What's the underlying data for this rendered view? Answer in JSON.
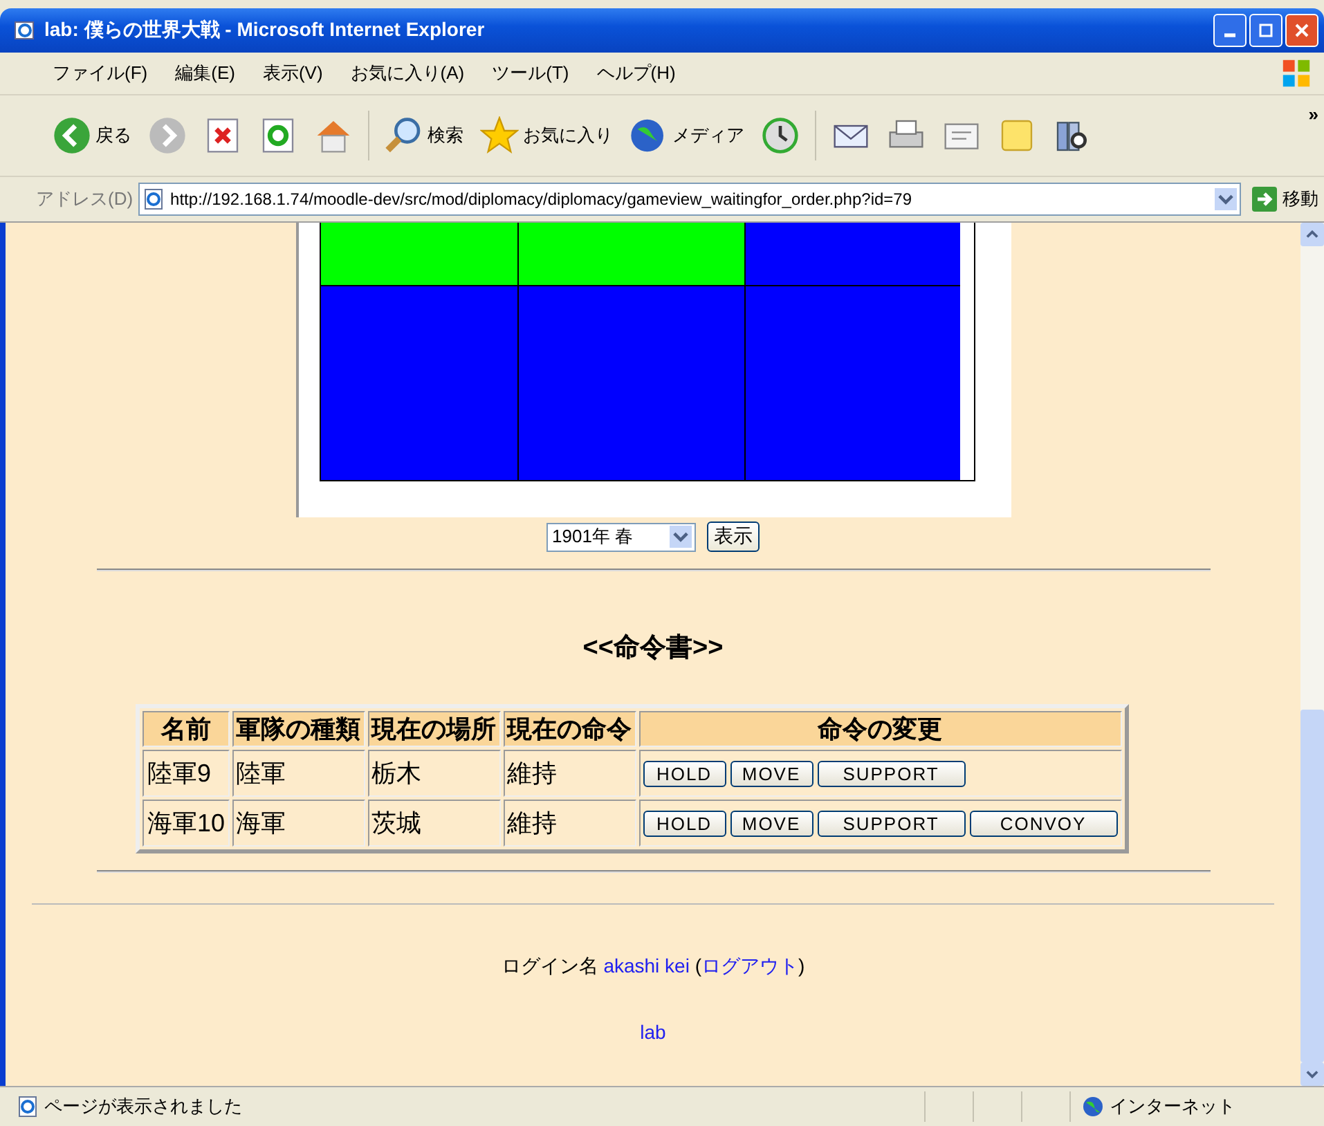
{
  "window": {
    "title": "lab: 僕らの世界大戦 - Microsoft Internet Explorer"
  },
  "menu": [
    "ファイル(F)",
    "編集(E)",
    "表示(V)",
    "お気に入り(A)",
    "ツール(T)",
    "ヘルプ(H)"
  ],
  "toolbar": [
    {
      "kind": "back",
      "label": "戻る"
    },
    {
      "kind": "forward"
    },
    {
      "kind": "stop"
    },
    {
      "kind": "refresh"
    },
    {
      "kind": "home"
    },
    {
      "kind": "separator"
    },
    {
      "kind": "search",
      "label": "検索"
    },
    {
      "kind": "favorites",
      "label": "お気に入り"
    },
    {
      "kind": "media",
      "label": "メディア"
    },
    {
      "kind": "history"
    },
    {
      "kind": "separator"
    },
    {
      "kind": "mail"
    },
    {
      "kind": "print"
    },
    {
      "kind": "edit"
    },
    {
      "kind": "note"
    },
    {
      "kind": "research"
    }
  ],
  "toolbar_more": "»",
  "address": {
    "label": "アドレス(D)",
    "url": "http://192.168.1.74/moodle-dev/src/mod/diplomacy/diplomacy/gameview_waitingfor_order.php?id=79",
    "go": "移動"
  },
  "map": {
    "rows": [
      [
        {
          "color": "#00ff00"
        },
        {
          "color": "#00ff00"
        },
        {
          "color": "#0000ff"
        }
      ],
      [
        {
          "color": "#0000ff"
        },
        {
          "color": "#0000ff"
        },
        {
          "color": "#0000ff"
        }
      ]
    ]
  },
  "season_select": {
    "value": "1901年 春"
  },
  "show_button": "表示",
  "heading": "<<命令書>>",
  "orders_table": {
    "columns": [
      "名前",
      "軍隊の種類",
      "現在の場所",
      "現在の命令",
      "命令の変更"
    ],
    "rows": [
      {
        "name": "陸軍9",
        "type": "陸軍",
        "location": "栃木",
        "order": "維持",
        "buttons": [
          "HOLD",
          "MOVE",
          "SUPPORT"
        ]
      },
      {
        "name": "海軍10",
        "type": "海軍",
        "location": "茨城",
        "order": "維持",
        "buttons": [
          "HOLD",
          "MOVE",
          "SUPPORT",
          "CONVOY"
        ]
      }
    ]
  },
  "footer": {
    "login_label": "ログイン名",
    "user": "akashi kei",
    "logout_open": "(",
    "logout": "ログアウト",
    "logout_close": ")",
    "site": "lab"
  },
  "status_bar": {
    "text": "ページが表示されました",
    "zone": "インターネット"
  }
}
